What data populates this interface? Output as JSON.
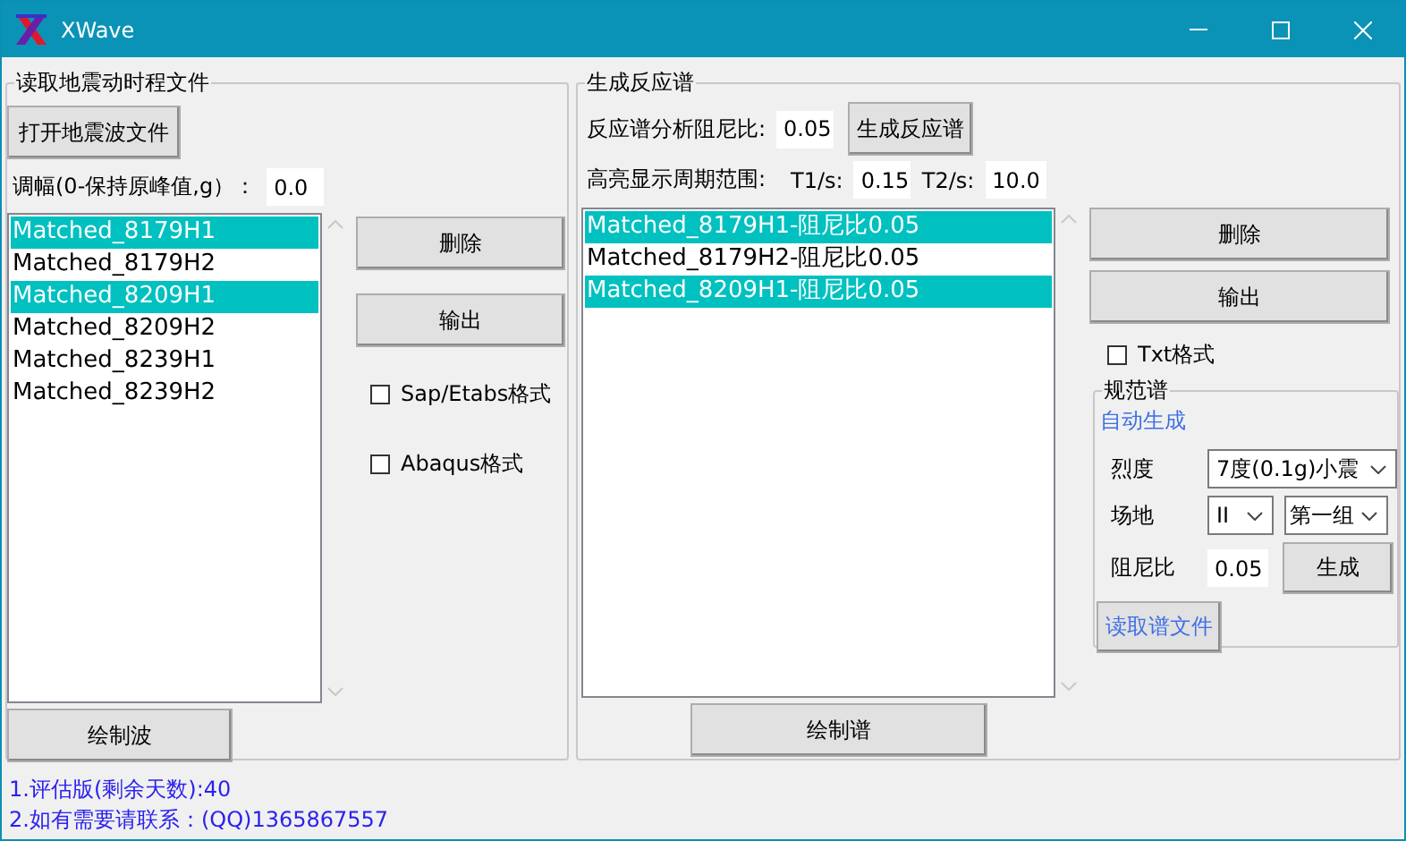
{
  "window": {
    "title": "XWave"
  },
  "left_panel": {
    "title": "读取地震动时程文件",
    "open_button": "打开地震波文件",
    "amplitude": {
      "label": "调幅(0-保持原峰值,g）：",
      "value": "0.0"
    },
    "files": [
      {
        "label": "Matched_8179H1",
        "selected": true
      },
      {
        "label": "Matched_8179H2",
        "selected": false
      },
      {
        "label": "Matched_8209H1",
        "selected": true
      },
      {
        "label": "Matched_8209H2",
        "selected": false
      },
      {
        "label": "Matched_8239H1",
        "selected": false
      },
      {
        "label": "Matched_8239H2",
        "selected": false
      }
    ],
    "buttons": [
      "删除",
      "输出"
    ],
    "formats": [
      {
        "label": "Sap/Etabs格式",
        "checked": false
      },
      {
        "label": "Abaqus格式",
        "checked": false
      }
    ],
    "plot_button": "绘制波"
  },
  "right_panel": {
    "title": "生成反应谱",
    "damping": {
      "label": "反应谱分析阻尼比:",
      "value": "0.05"
    },
    "generate_button": "生成反应谱",
    "period_range": {
      "label": "高亮显示周期范围:",
      "t1_label": "T1/s:",
      "t1_value": "0.15",
      "t2_label": "T2/s:",
      "t2_value": "10.0"
    },
    "spectra": [
      {
        "label": "Matched_8179H1-阻尼比0.05",
        "selected": true
      },
      {
        "label": "Matched_8179H2-阻尼比0.05",
        "selected": false
      },
      {
        "label": "Matched_8209H1-阻尼比0.05",
        "selected": true
      }
    ],
    "buttons": [
      "删除",
      "输出"
    ],
    "formats": [
      {
        "label": "Txt格式",
        "checked": false
      }
    ],
    "code_spectrum": {
      "title": "规范谱",
      "auto_link": "自动生成",
      "intensity": {
        "label": "烈度",
        "value": "7度(0.1g)小震"
      },
      "site": {
        "label": "场地",
        "class_value": "II",
        "group_value": "第一组"
      },
      "damping": {
        "label": "阻尼比",
        "value": "0.05"
      },
      "generate_button": "生成",
      "read_button": "读取谱文件"
    },
    "plot_button": "绘制谱"
  },
  "status_lines": [
    "1.评估版(剩余天数):40",
    "2.如有需要请联系：(QQ)1365867557"
  ]
}
